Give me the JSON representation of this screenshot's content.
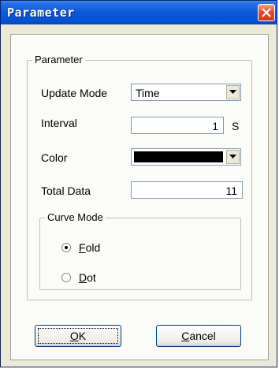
{
  "window": {
    "title": "Parameter"
  },
  "group": {
    "label": "Parameter"
  },
  "fields": {
    "update_mode": {
      "label": "Update Mode",
      "value": "Time"
    },
    "interval": {
      "label": "Interval",
      "value": "1",
      "unit": "S"
    },
    "color": {
      "label": "Color",
      "value_hex": "#000000"
    },
    "total_data": {
      "label": "Total Data",
      "value": "11"
    }
  },
  "curve_mode": {
    "label": "Curve Mode",
    "options": [
      {
        "first": "F",
        "rest": "old",
        "selected": true
      },
      {
        "first": "D",
        "rest": "ot",
        "selected": false
      }
    ]
  },
  "buttons": {
    "ok": {
      "first": "O",
      "rest": "K"
    },
    "cancel": {
      "first": "C",
      "rest": "ancel"
    }
  },
  "colors": {
    "titlebar": "#0351d6",
    "close": "#e0502e",
    "dialog_bg": "#ece9d8"
  }
}
